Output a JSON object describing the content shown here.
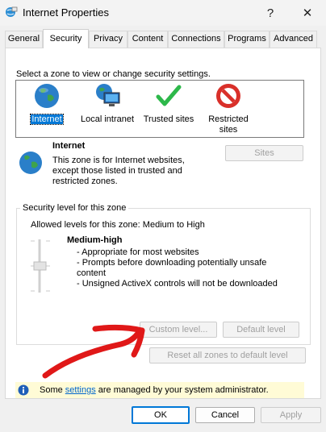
{
  "window": {
    "title": "Internet Properties",
    "help_glyph": "?",
    "close_glyph": "✕"
  },
  "tabs": [
    {
      "label": "General",
      "active": false
    },
    {
      "label": "Security",
      "active": true
    },
    {
      "label": "Privacy",
      "active": false
    },
    {
      "label": "Content",
      "active": false
    },
    {
      "label": "Connections",
      "active": false
    },
    {
      "label": "Programs",
      "active": false
    },
    {
      "label": "Advanced",
      "active": false
    }
  ],
  "security": {
    "select_zone_prompt": "Select a zone to view or change security settings.",
    "zones": [
      {
        "label": "Internet",
        "icon": "globe-icon",
        "selected": true
      },
      {
        "label": "Local intranet",
        "icon": "monitor-icon",
        "selected": false
      },
      {
        "label": "Trusted sites",
        "icon": "checkmark-icon",
        "selected": false
      },
      {
        "label_line1": "Restricted",
        "label_line2": "sites",
        "icon": "no-entry-icon",
        "selected": false
      }
    ],
    "zone_info": {
      "title": "Internet",
      "line1": "This zone is for Internet websites,",
      "line2": "except those listed in trusted and",
      "line3": "restricted zones."
    },
    "sites_button": "Sites",
    "group_title": "Security level for this zone",
    "allowed_levels": "Allowed levels for this zone: Medium to High",
    "level_name": "Medium-high",
    "level_bullets": [
      "- Appropriate for most websites",
      "- Prompts before downloading potentially unsafe",
      "content",
      "- Unsigned ActiveX controls will not be downloaded"
    ],
    "custom_level_button": "Custom level...",
    "default_level_button": "Default level",
    "reset_all_button": "Reset all zones to default level",
    "admin_notice": {
      "prefix": "Some ",
      "link": "settings",
      "suffix": " are managed by your system administrator."
    }
  },
  "footer": {
    "ok": "OK",
    "cancel": "Cancel",
    "apply": "Apply"
  },
  "colors": {
    "selection": "#0078d7",
    "notice_bg": "#fffbd6",
    "annotation_arrow": "#e01818"
  }
}
